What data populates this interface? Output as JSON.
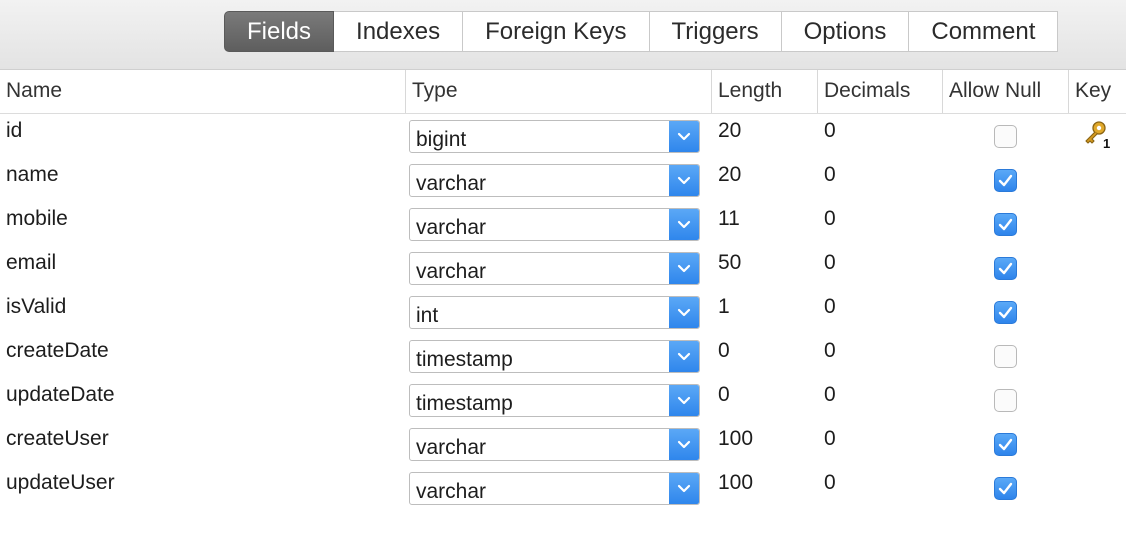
{
  "tabs": [
    {
      "label": "Fields",
      "active": true
    },
    {
      "label": "Indexes",
      "active": false
    },
    {
      "label": "Foreign Keys",
      "active": false
    },
    {
      "label": "Triggers",
      "active": false
    },
    {
      "label": "Options",
      "active": false
    },
    {
      "label": "Comment",
      "active": false
    }
  ],
  "columns": {
    "name": "Name",
    "type": "Type",
    "length": "Length",
    "decimals": "Decimals",
    "allow_null": "Allow Null",
    "key": "Key"
  },
  "rows": [
    {
      "name": "id",
      "type": "bigint",
      "length": "20",
      "decimals": "0",
      "allow_null": false,
      "key": "1"
    },
    {
      "name": "name",
      "type": "varchar",
      "length": "20",
      "decimals": "0",
      "allow_null": true,
      "key": ""
    },
    {
      "name": "mobile",
      "type": "varchar",
      "length": "11",
      "decimals": "0",
      "allow_null": true,
      "key": ""
    },
    {
      "name": "email",
      "type": "varchar",
      "length": "50",
      "decimals": "0",
      "allow_null": true,
      "key": ""
    },
    {
      "name": "isValid",
      "type": "int",
      "length": "1",
      "decimals": "0",
      "allow_null": true,
      "key": ""
    },
    {
      "name": "createDate",
      "type": "timestamp",
      "length": "0",
      "decimals": "0",
      "allow_null": false,
      "key": ""
    },
    {
      "name": "updateDate",
      "type": "timestamp",
      "length": "0",
      "decimals": "0",
      "allow_null": false,
      "key": ""
    },
    {
      "name": "createUser",
      "type": "varchar",
      "length": "100",
      "decimals": "0",
      "allow_null": true,
      "key": ""
    },
    {
      "name": "updateUser",
      "type": "varchar",
      "length": "100",
      "decimals": "0",
      "allow_null": true,
      "key": ""
    }
  ],
  "colors": {
    "accent": "#2f86ec",
    "active_tab": "#5e5e5e",
    "key_gold": "#e0a82a"
  }
}
